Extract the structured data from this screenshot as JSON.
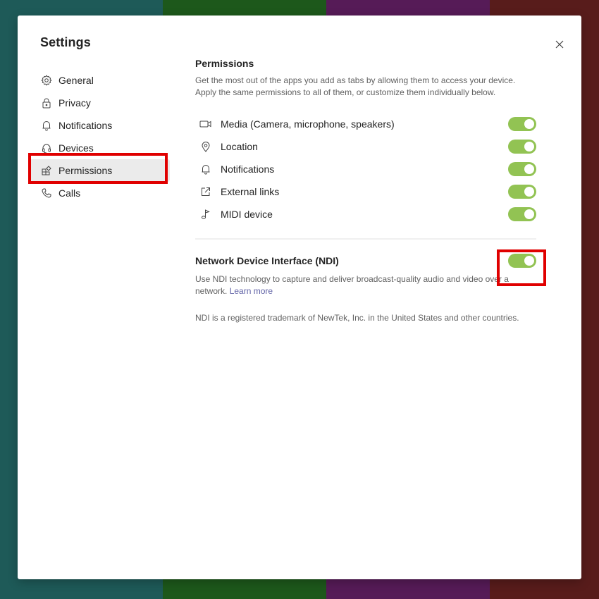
{
  "dialog": {
    "title": "Settings",
    "close_icon": "close-icon"
  },
  "nav": {
    "items": [
      {
        "label": "General",
        "icon": "gear-icon",
        "active": false
      },
      {
        "label": "Privacy",
        "icon": "lock-icon",
        "active": false
      },
      {
        "label": "Notifications",
        "icon": "bell-icon",
        "active": false
      },
      {
        "label": "Devices",
        "icon": "headset-icon",
        "active": false
      },
      {
        "label": "Permissions",
        "icon": "apps-icon",
        "active": true
      },
      {
        "label": "Calls",
        "icon": "phone-icon",
        "active": false
      }
    ]
  },
  "permissions": {
    "title": "Permissions",
    "description": "Get the most out of the apps you add as tabs by allowing them to access your device. Apply the same permissions to all of them, or customize them individually below.",
    "items": [
      {
        "label": "Media (Camera, microphone, speakers)",
        "icon": "camera-icon",
        "enabled": true
      },
      {
        "label": "Location",
        "icon": "location-pin-icon",
        "enabled": true
      },
      {
        "label": "Notifications",
        "icon": "bell-icon",
        "enabled": true
      },
      {
        "label": "External links",
        "icon": "external-link-icon",
        "enabled": true
      },
      {
        "label": "MIDI device",
        "icon": "music-note-icon",
        "enabled": true
      }
    ]
  },
  "ndi": {
    "title": "Network Device Interface (NDI)",
    "enabled": true,
    "description": "Use NDI technology to capture and deliver broadcast-quality audio and video over a network.",
    "learn_more": "Learn more",
    "trademark": "NDI is a registered trademark of NewTek, Inc. in the United States and other countries."
  },
  "colors": {
    "toggle_on": "#92c353",
    "link": "#6264a7",
    "highlight": "#e00000"
  }
}
